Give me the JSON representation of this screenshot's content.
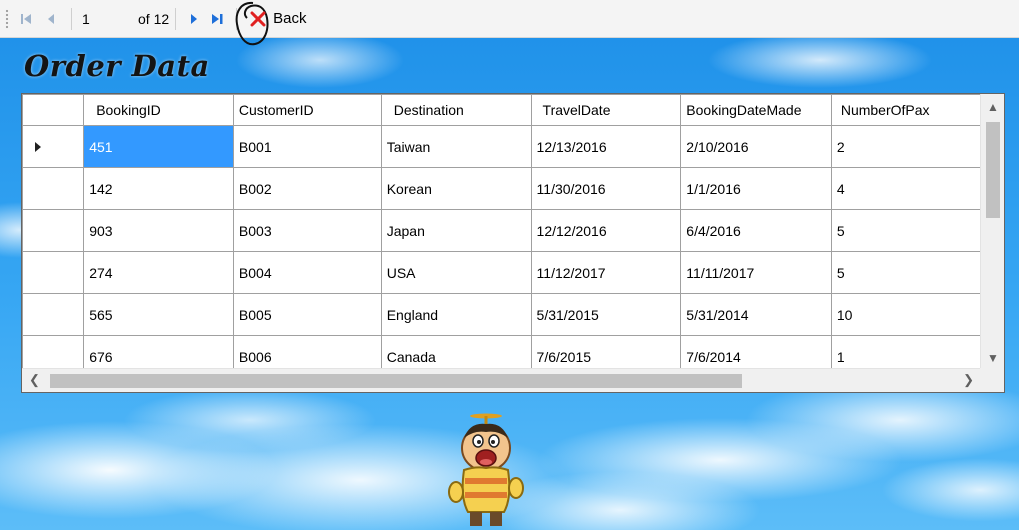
{
  "navigator": {
    "position": "1",
    "count_label": "of 12",
    "back_label": "Back"
  },
  "page_title": "Order Data",
  "grid": {
    "columns": [
      "BookingID",
      "CustomerID",
      "Destination",
      "TravelDate",
      "BookingDateMade",
      "NumberOfPax"
    ],
    "rows": [
      [
        "451",
        "B001",
        "Taiwan",
        "12/13/2016",
        "2/10/2016",
        "2"
      ],
      [
        "142",
        "B002",
        "Korean",
        "11/30/2016",
        "1/1/2016",
        "4"
      ],
      [
        "903",
        "B003",
        "Japan",
        "12/12/2016",
        "6/4/2016",
        "5"
      ],
      [
        "274",
        "B004",
        "USA",
        "11/12/2017",
        "11/11/2017",
        "5"
      ],
      [
        "565",
        "B005",
        "England",
        "5/31/2015",
        "5/31/2014",
        "10"
      ],
      [
        "676",
        "B006",
        "Canada",
        "7/6/2015",
        "7/6/2014",
        "1"
      ]
    ]
  },
  "colors": {
    "selection": "#3399ff",
    "delete_icon": "#e02020",
    "nav_icon": "#1e6fd9"
  }
}
